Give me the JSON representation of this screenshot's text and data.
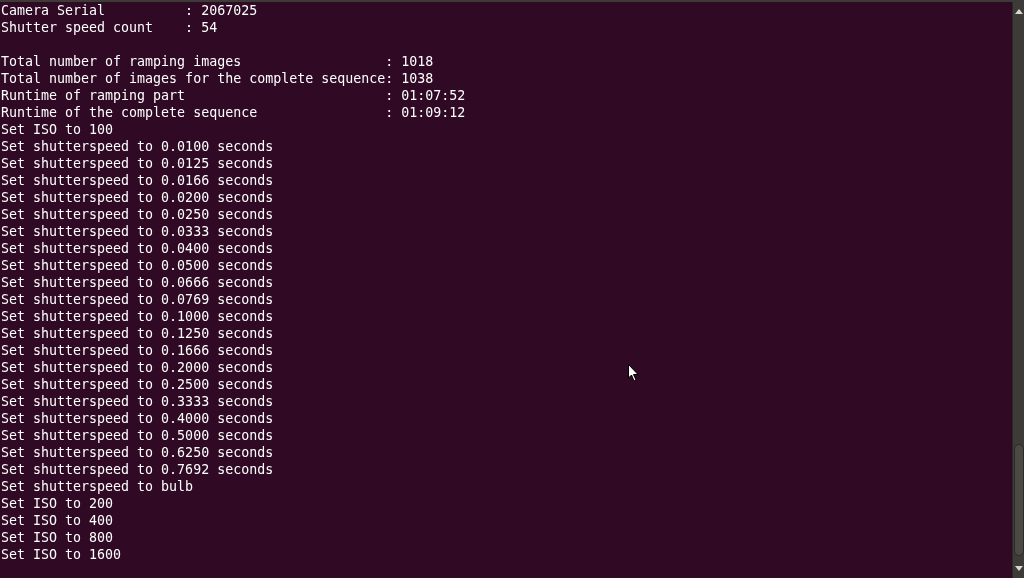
{
  "terminal": {
    "output_blocks": [
      {
        "lines": [
          "Camera Serial          : 2067025",
          "Shutter speed count    : 54"
        ]
      },
      {
        "lines": [
          "Total number of ramping images                  : 1018",
          "Total number of images for the complete sequence: 1038",
          "Runtime of ramping part                         : 01:07:52",
          "Runtime of the complete sequence                : 01:09:12",
          "Set ISO to 100",
          "Set shutterspeed to 0.0100 seconds",
          "Set shutterspeed to 0.0125 seconds",
          "Set shutterspeed to 0.0166 seconds",
          "Set shutterspeed to 0.0200 seconds",
          "Set shutterspeed to 0.0250 seconds",
          "Set shutterspeed to 0.0333 seconds",
          "Set shutterspeed to 0.0400 seconds",
          "Set shutterspeed to 0.0500 seconds",
          "Set shutterspeed to 0.0666 seconds",
          "Set shutterspeed to 0.0769 seconds",
          "Set shutterspeed to 0.1000 seconds",
          "Set shutterspeed to 0.1250 seconds",
          "Set shutterspeed to 0.1666 seconds",
          "Set shutterspeed to 0.2000 seconds",
          "Set shutterspeed to 0.2500 seconds",
          "Set shutterspeed to 0.3333 seconds",
          "Set shutterspeed to 0.4000 seconds",
          "Set shutterspeed to 0.5000 seconds",
          "Set shutterspeed to 0.6250 seconds",
          "Set shutterspeed to 0.7692 seconds",
          "Set shutterspeed to bulb",
          "Set ISO to 200",
          "Set ISO to 400",
          "Set ISO to 800",
          "Set ISO to 1600"
        ]
      }
    ]
  }
}
